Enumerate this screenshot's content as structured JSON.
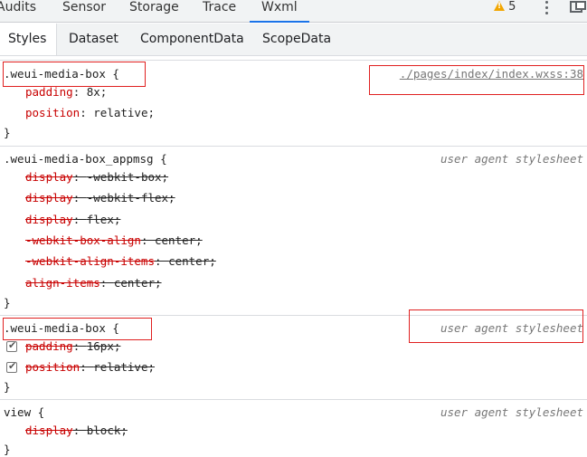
{
  "top_tabs": [
    {
      "label": "Audits",
      "active": false
    },
    {
      "label": "Sensor",
      "active": false
    },
    {
      "label": "Storage",
      "active": false
    },
    {
      "label": "Trace",
      "active": false
    },
    {
      "label": "Wxml",
      "active": true
    }
  ],
  "warnings": {
    "count": "5",
    "icon": "warning-triangle-icon"
  },
  "sub_tabs": [
    {
      "label": "Styles",
      "active": true
    },
    {
      "label": "Dataset",
      "active": false
    },
    {
      "label": "ComponentData",
      "active": false
    },
    {
      "label": "ScopeData",
      "active": false
    }
  ],
  "rules": [
    {
      "selector": ".weui-media-box {",
      "source": "./pages/index/index.wxss:38",
      "props": [
        {
          "name": "padding",
          "value": "8x;",
          "struck": false
        },
        {
          "name": "position",
          "value": "relative;",
          "struck": false
        }
      ],
      "close": "}"
    },
    {
      "selector": ".weui-media-box_appmsg {",
      "source": "user agent stylesheet",
      "props": [
        {
          "name": "display",
          "value": "-webkit-box;",
          "struck": true
        },
        {
          "name": "display",
          "value": "-webkit-flex;",
          "struck": true
        },
        {
          "name": "display",
          "value": "flex;",
          "struck": true
        },
        {
          "name": "-webkit-box-align",
          "value": "center;",
          "struck": true
        },
        {
          "name": "-webkit-align-items",
          "value": "center;",
          "struck": true
        },
        {
          "name": "align-items",
          "value": "center;",
          "struck": true
        }
      ],
      "close": "}"
    },
    {
      "selector": ".weui-media-box {",
      "source": "user agent stylesheet",
      "props": [
        {
          "name": "padding",
          "value": "16px;",
          "struck": true,
          "checked": true
        },
        {
          "name": "position",
          "value": "relative;",
          "struck": true,
          "checked": true
        }
      ],
      "close": "}"
    },
    {
      "selector": "view {",
      "source": "user agent stylesheet",
      "props": [
        {
          "name": "display",
          "value": "block;",
          "struck": true
        }
      ],
      "close": "}"
    }
  ]
}
